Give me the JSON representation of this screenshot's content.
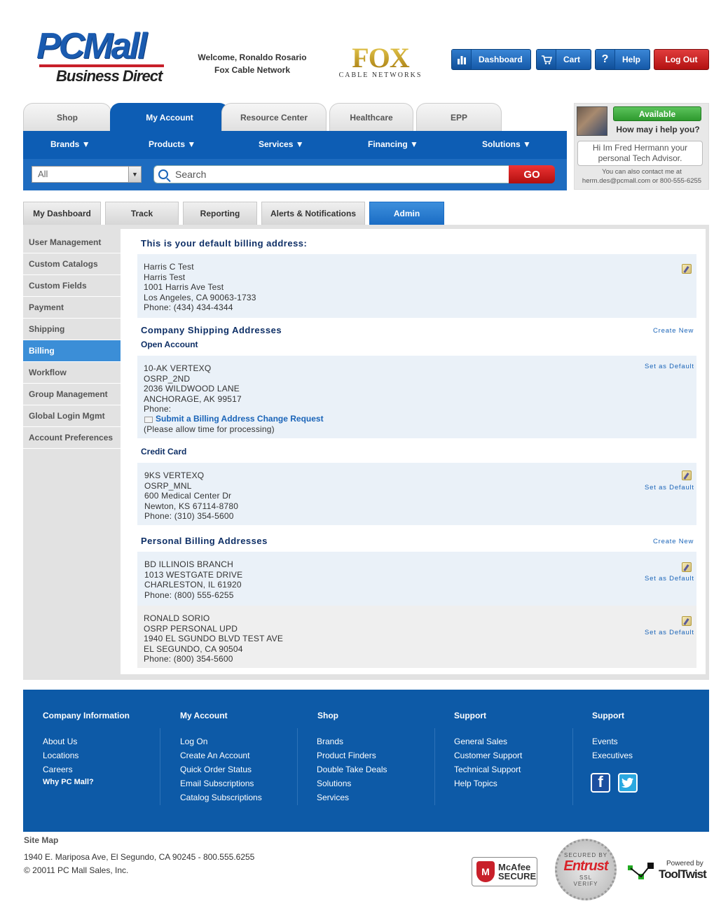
{
  "header": {
    "logo_main": "PCMall",
    "logo_sub": "Business Direct",
    "welcome_line1": "Welcome, Ronaldo Rosario",
    "welcome_line2": "Fox Cable Network",
    "partner_logo_big": "FOX",
    "partner_logo_small": "CABLE NETWORKS",
    "buttons": {
      "dashboard": "Dashboard",
      "cart": "Cart",
      "help": "Help",
      "logout": "Log Out"
    }
  },
  "tabs": [
    "Shop",
    "My Account",
    "Resource Center",
    "Healthcare",
    "EPP"
  ],
  "active_tab": "My Account",
  "nav": [
    "Brands",
    "Products",
    "Services",
    "Financing",
    "Solutions"
  ],
  "search": {
    "category": "All",
    "placeholder": "Search",
    "go_label": "GO"
  },
  "advisor": {
    "status": "Available",
    "question": "How may i help you?",
    "message": "Hi Im Fred Hermann your personal Tech Advisor.",
    "contact_line1": "You can also contact me at",
    "contact_line2": "herm.des@pcmall.com or 800-555-6255"
  },
  "subtabs": [
    "My Dashboard",
    "Track",
    "Reporting",
    "Alerts & Notifications",
    "Admin"
  ],
  "active_subtab": "Admin",
  "sidebar": [
    "User Management",
    "Custom Catalogs",
    "Custom Fields",
    "Payment",
    "Shipping",
    "Billing",
    "Workflow",
    "Group Management",
    "Global Login Mgmt",
    "Account Preferences"
  ],
  "active_sidebar": "Billing",
  "billing": {
    "default_heading": "This is your default billing address:",
    "default_address": [
      "Harris C Test",
      "Harris Test",
      "1001 Harris Ave Test",
      "Los Angeles, CA 90063-1733",
      "Phone: (434) 434-4344"
    ],
    "company_heading": "Company Shipping Addresses",
    "create_new": "Create New",
    "open_account_heading": "Open Account",
    "set_as_default": "Set as Default",
    "open_account_address": [
      "10-AK VERTEXQ",
      "OSRP_2ND",
      "2036 WILDWOOD LANE",
      "ANCHORAGE, AK 99517",
      "Phone:"
    ],
    "change_request_link": "Submit a Billing Address Change Request",
    "change_request_note": "(Please allow time for processing)",
    "credit_card_heading": "Credit Card",
    "credit_card_address": [
      "9KS VERTEXQ",
      "OSRP_MNL",
      "600 Medical Center Dr",
      "Newton, KS 67114-8780",
      "Phone: (310) 354-5600"
    ],
    "personal_heading": "Personal Billing Addresses",
    "personal_addresses": [
      [
        "BD ILLINOIS BRANCH",
        "1013 WESTGATE DRIVE",
        "CHARLESTON, IL 61920",
        "Phone: (800) 555-6255"
      ],
      [
        "RONALD SORIO",
        "OSRP PERSONAL UPD",
        "1940 EL SGUNDO BLVD TEST AVE",
        "EL SEGUNDO, CA 90504",
        "Phone: (800) 354-5600"
      ]
    ]
  },
  "footer": {
    "columns": [
      {
        "title": "Company Information",
        "links": [
          "About Us",
          "Locations",
          "Careers"
        ],
        "extra": "Why PC Mall?"
      },
      {
        "title": "My Account",
        "links": [
          "Log On",
          "Create An Account",
          "Quick Order Status",
          "Email Subscriptions",
          "Catalog Subscriptions"
        ]
      },
      {
        "title": "Shop",
        "links": [
          "Brands",
          "Product Finders",
          "Double Take Deals",
          "Solutions",
          "Services"
        ]
      },
      {
        "title": "Support",
        "links": [
          "General Sales",
          "Customer Support",
          "Technical Support",
          "Help Topics"
        ]
      },
      {
        "title": "Support",
        "links": [
          "Events",
          "Executives"
        ]
      }
    ],
    "site_map": "Site Map",
    "address": "1940 E. Mariposa Ave, El Segundo, CA 90245 - 800.555.6255",
    "copyright": "© 20011 PC Mall Sales, Inc.",
    "badges": {
      "mcafee_line1": "McAfee",
      "mcafee_line2": "SECURE",
      "entrust_top": "SECURED BY",
      "entrust": "Entrust",
      "entrust_ssl": "SSL",
      "entrust_bottom": "VERIFY",
      "powered_by": "Powered by",
      "tooltwist": "ToolTwist"
    }
  },
  "colors": {
    "primary_blue": "#0d5db4",
    "go_red": "#d41c1c",
    "available_green": "#3aa83a",
    "heading_navy": "#0e2f66"
  }
}
